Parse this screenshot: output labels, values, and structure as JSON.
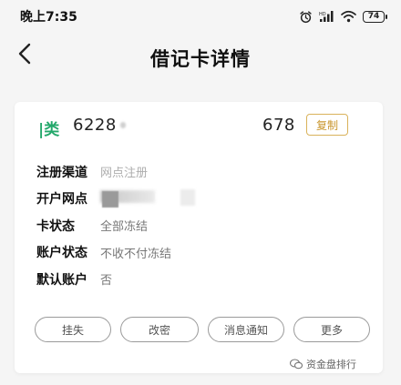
{
  "status_bar": {
    "time": "晚上7:35",
    "battery": "74",
    "icons": [
      "alarm-icon",
      "signal-icon",
      "wifi-icon",
      "battery-icon"
    ]
  },
  "nav": {
    "title": "借记卡详情",
    "back_icon": "chevron-left-icon"
  },
  "card": {
    "bank_tag": "|类",
    "number_start": "6228",
    "number_end": "678",
    "copy_label": "复制",
    "details": [
      {
        "label": "注册渠道",
        "value": "网点注册"
      },
      {
        "label": "开户网点",
        "value": ""
      },
      {
        "label": "卡状态",
        "value": "全部冻结"
      },
      {
        "label": "账户状态",
        "value": "不收不付冻结"
      },
      {
        "label": "默认账户",
        "value": "否"
      }
    ],
    "actions": [
      "挂失",
      "改密",
      "消息通知",
      "更多"
    ]
  },
  "watermark": "资金盘排行",
  "colors": {
    "accent_green": "#23a86b",
    "copy_gold": "#c9962e",
    "background": "#f5f5f5"
  }
}
